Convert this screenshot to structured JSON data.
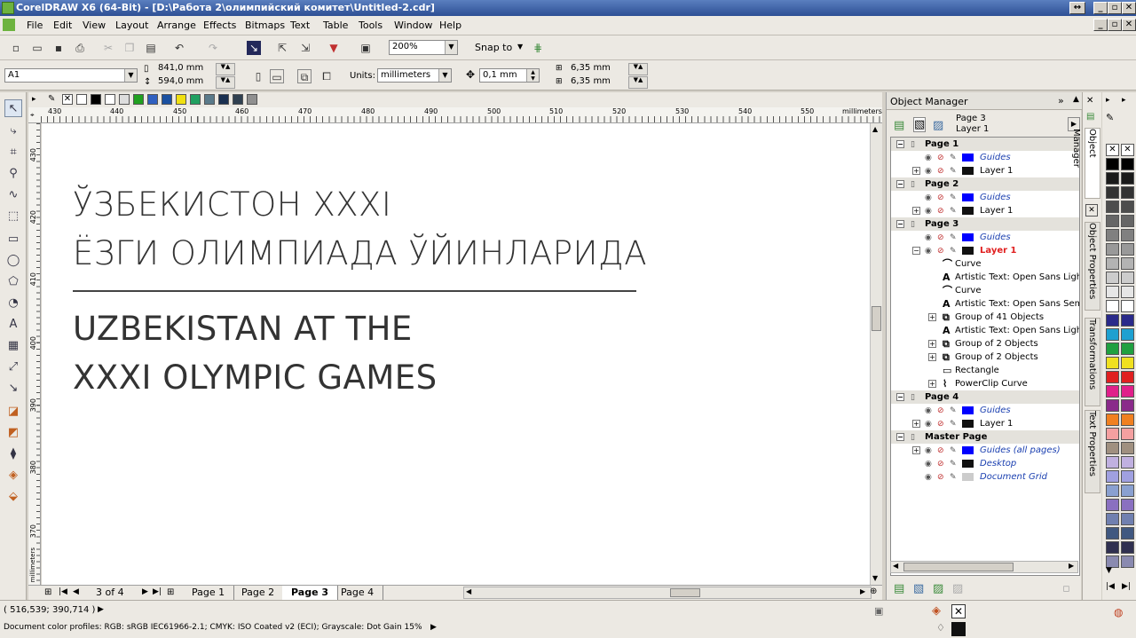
{
  "window": {
    "title": "CorelDRAW X6 (64-Bit) - [D:\\Работа 2\\олимпийский комитет\\Untitled-2.cdr]"
  },
  "menu": [
    "File",
    "Edit",
    "View",
    "Layout",
    "Arrange",
    "Effects",
    "Bitmaps",
    "Text",
    "Table",
    "Tools",
    "Window",
    "Help"
  ],
  "toolbar": {
    "zoom": "200%",
    "snap_to": "Snap to"
  },
  "propbar": {
    "page_size": "A1",
    "width": "841,0 mm",
    "height": "594,0 mm",
    "units_label": "Units:",
    "units": "millimeters",
    "nudge": "0,1 mm",
    "dup_x": "6,35 mm",
    "dup_y": "6,35 mm"
  },
  "ruler": {
    "h_ticks": [
      "430",
      "440",
      "450",
      "460",
      "470",
      "480",
      "490",
      "500",
      "510",
      "520",
      "530",
      "540",
      "550"
    ],
    "h_unit": "millimeters",
    "v_ticks": [
      "430",
      "420",
      "410",
      "400",
      "390",
      "380",
      "370"
    ],
    "v_unit": "millimeters"
  },
  "canvas": {
    "uz_line1": "ЎЗБЕКИСТОН XXXI",
    "uz_line2": "ЁЗГИ ОЛИМПИАДА ЎЙИНЛАРИДА",
    "en_line1": "UZBEKISTAN AT THE",
    "en_line2": "XXXI OLYMPIC GAMES"
  },
  "pagenav": {
    "counter": "3 of 4",
    "tabs": [
      "Page 1",
      "Page 2",
      "Page 3",
      "Page 4"
    ],
    "active": "Page 3"
  },
  "status": {
    "coords": "( 516,539; 390,714 )",
    "profiles": "Document color profiles: RGB: sRGB IEC61966-2.1; CMYK: ISO Coated v2 (ECI); Grayscale: Dot Gain 15%"
  },
  "object_manager": {
    "title": "Object Manager",
    "current_page": "Page 3",
    "current_layer": "Layer 1",
    "tree": [
      {
        "kind": "page",
        "label": "Page 1"
      },
      {
        "kind": "layer",
        "label": "Guides",
        "italic": true,
        "color": "#0000ff"
      },
      {
        "kind": "layer",
        "label": "Layer 1",
        "color": "#111111",
        "expand": true
      },
      {
        "kind": "page",
        "label": "Page 2"
      },
      {
        "kind": "layer",
        "label": "Guides",
        "italic": true,
        "color": "#0000ff"
      },
      {
        "kind": "layer",
        "label": "Layer 1",
        "color": "#111111",
        "expand": true
      },
      {
        "kind": "page",
        "label": "Page 3"
      },
      {
        "kind": "layer",
        "label": "Guides",
        "italic": true,
        "color": "#0000ff"
      },
      {
        "kind": "layer",
        "label": "Layer 1",
        "color": "#111111",
        "expand": true,
        "active": true
      },
      {
        "kind": "obj",
        "label": "Curve",
        "icon": "curve"
      },
      {
        "kind": "obj",
        "label": "Artistic Text: Open Sans Light (",
        "icon": "text"
      },
      {
        "kind": "obj",
        "label": "Curve",
        "icon": "curve"
      },
      {
        "kind": "obj",
        "label": "Artistic Text: Open Sans Semibo",
        "icon": "text"
      },
      {
        "kind": "obj",
        "label": "Group of 41 Objects",
        "icon": "group",
        "expand": true
      },
      {
        "kind": "obj",
        "label": "Artistic Text: Open Sans Light (",
        "icon": "text"
      },
      {
        "kind": "obj",
        "label": "Group of 2 Objects",
        "icon": "group",
        "expand": true
      },
      {
        "kind": "obj",
        "label": "Group of 2 Objects",
        "icon": "group",
        "expand": true
      },
      {
        "kind": "obj",
        "label": "Rectangle",
        "icon": "rect"
      },
      {
        "kind": "obj",
        "label": "PowerClip Curve",
        "icon": "powerclip",
        "expand": true
      },
      {
        "kind": "page",
        "label": "Page 4"
      },
      {
        "kind": "layer",
        "label": "Guides",
        "italic": true,
        "color": "#0000ff"
      },
      {
        "kind": "layer",
        "label": "Layer 1",
        "color": "#111111",
        "expand": true
      },
      {
        "kind": "page",
        "label": "Master Page"
      },
      {
        "kind": "layer",
        "label": "Guides (all pages)",
        "italic": true,
        "color": "#0000ff",
        "expand": true
      },
      {
        "kind": "layer",
        "label": "Desktop",
        "italic": true,
        "color": "#111111"
      },
      {
        "kind": "layer",
        "label": "Document Grid",
        "italic": true,
        "color": "#cccccc"
      }
    ]
  },
  "side_tabs": [
    "Object Manager",
    "Object Properties",
    "Transformations",
    "Text Properties"
  ],
  "doc_palette": [
    "#ffffff",
    "#000000",
    "#ffffff",
    "#dddddd",
    "#20a020",
    "#3060c0",
    "#1a50a0",
    "#f0e010",
    "#20a060",
    "#5a7a8a",
    "#1a3050",
    "#304050",
    "#909090"
  ],
  "right_palette": [
    "#000000",
    "#1a1a1a",
    "#333333",
    "#4d4d4d",
    "#666666",
    "#808080",
    "#999999",
    "#b3b3b3",
    "#cccccc",
    "#e6e6e6",
    "#ffffff",
    "#2a2a8a",
    "#1ea0d0",
    "#20a040",
    "#f0e020",
    "#e02020",
    "#e0208a",
    "#8a2a8a",
    "#f08020",
    "#f4a0a0",
    "#a09080",
    "#c0b0e0",
    "#a0a0e0",
    "#8aa0d0",
    "#8a70c0",
    "#7080b0",
    "#405880",
    "#303050",
    "#8a8ab0"
  ]
}
